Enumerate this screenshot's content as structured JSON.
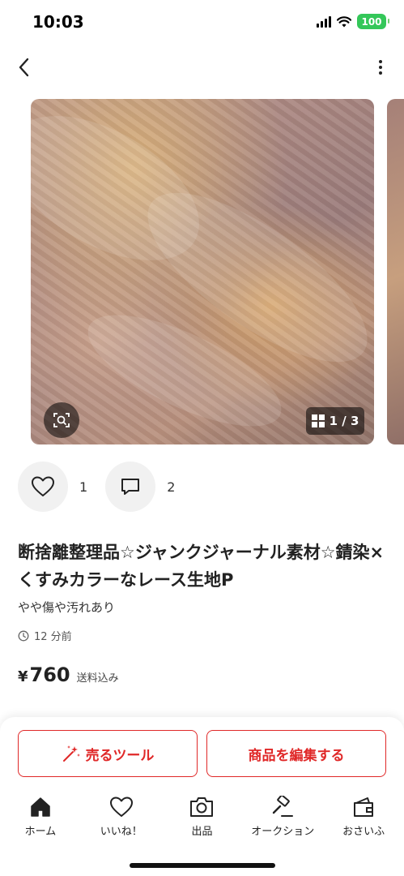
{
  "status_bar": {
    "time": "10:03",
    "battery": "100",
    "battery_color": "#34c759"
  },
  "carousel": {
    "counter": "1 / 3"
  },
  "reactions": {
    "likes": "1",
    "comments": "2"
  },
  "item": {
    "title": "断捨離整理品☆ジャンクジャーナル素材☆錆染×くすみカラーなレース生地P",
    "condition": "やや傷や汚れあり",
    "posted": "12 分前",
    "price_symbol": "¥",
    "price": "760",
    "shipping": "送料込み"
  },
  "actions": {
    "sell_tool_label": "売るツール",
    "edit_label": "商品を編集する",
    "accent_color": "#e02828"
  },
  "tabbar": {
    "items": [
      {
        "label": "ホーム",
        "icon": "home-icon"
      },
      {
        "label": "いいね！",
        "icon": "heart-icon"
      },
      {
        "label": "出品",
        "icon": "camera-icon"
      },
      {
        "label": "オークション",
        "icon": "gavel-icon"
      },
      {
        "label": "おさいふ",
        "icon": "wallet-icon"
      }
    ]
  }
}
